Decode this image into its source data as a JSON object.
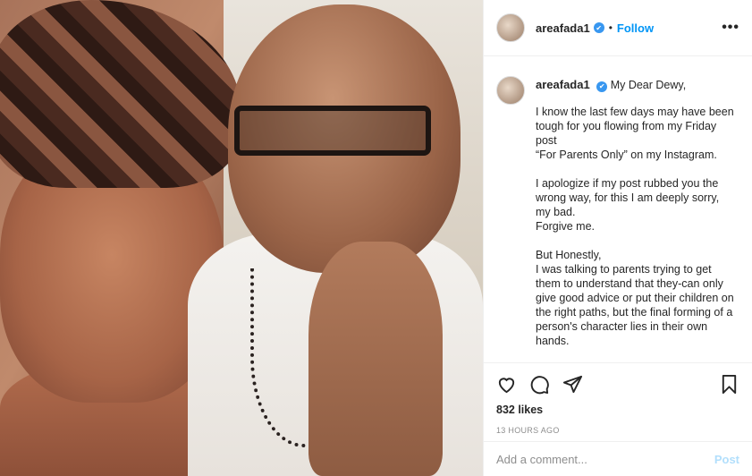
{
  "post": {
    "image_alt": "photo",
    "username": "areafada1",
    "follow_label": "Follow",
    "separator": "•",
    "verified_icon": "✔",
    "more_icon": "•••"
  },
  "caption": {
    "username": "areafada1",
    "greeting": "My Dear Dewy,",
    "body": "I know the last few days may have been tough for you flowing from my Friday post\n“For Parents Only” on my Instagram.\n\nI apologize if my post rubbed you the wrong way, for this I am deeply sorry, my bad.\nForgive me.\n\nBut Honestly,\nI was talking to parents trying to get them to understand that they-can only give good advice or put their children on the right paths, but the final forming of a person's character lies in their own hands."
  },
  "actions": {
    "icons": [
      "heart-icon",
      "comment-icon",
      "share-icon",
      "bookmark-icon"
    ],
    "likes": "832 likes",
    "timestamp": "13 HOURS AGO"
  },
  "comment": {
    "placeholder": "Add a comment...",
    "post_label": "Post"
  },
  "colors": {
    "accent": "#0095f6",
    "verified": "#3897f0",
    "post_disabled": "#b2dffc",
    "muted": "#8e8e8e"
  }
}
